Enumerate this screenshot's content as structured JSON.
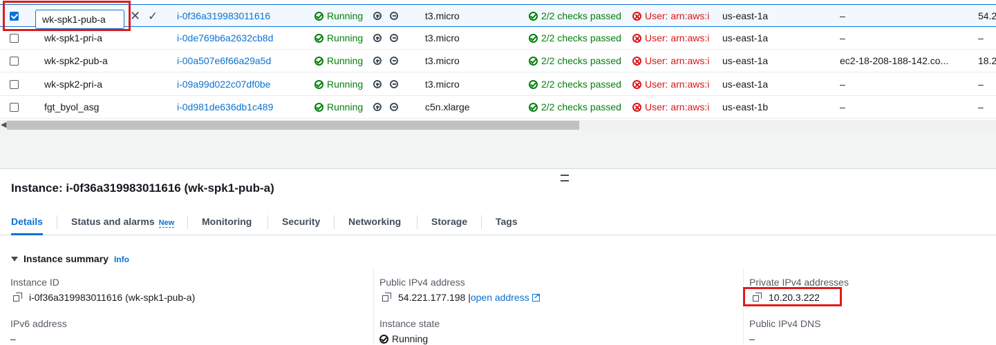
{
  "rows": [
    {
      "name": "wk-spk1-pub-a",
      "id": "i-0f36a319983011616",
      "state": "Running",
      "type": "t3.micro",
      "checks": "2/2 checks passed",
      "alarm": "User: arn:aws:i",
      "az": "us-east-1a",
      "dns": "–",
      "ip": "54.2",
      "selected": true,
      "editing": true
    },
    {
      "name": "wk-spk1-pri-a",
      "id": "i-0de769b6a2632cb8d",
      "state": "Running",
      "type": "t3.micro",
      "checks": "2/2 checks passed",
      "alarm": "User: arn:aws:i",
      "az": "us-east-1a",
      "dns": "–",
      "ip": "–"
    },
    {
      "name": "wk-spk2-pub-a",
      "id": "i-00a507e6f66a29a5d",
      "state": "Running",
      "type": "t3.micro",
      "checks": "2/2 checks passed",
      "alarm": "User: arn:aws:i",
      "az": "us-east-1a",
      "dns": "ec2-18-208-188-142.co...",
      "ip": "18.2"
    },
    {
      "name": "wk-spk2-pri-a",
      "id": "i-09a99d022c07df0be",
      "state": "Running",
      "type": "t3.micro",
      "checks": "2/2 checks passed",
      "alarm": "User: arn:aws:i",
      "az": "us-east-1a",
      "dns": "–",
      "ip": "–"
    },
    {
      "name": "fgt_byol_asg",
      "id": "i-0d981de636db1c489",
      "state": "Running",
      "type": "c5n.xlarge",
      "checks": "2/2 checks passed",
      "alarm": "User: arn:aws:i",
      "az": "us-east-1b",
      "dns": "–",
      "ip": "–"
    }
  ],
  "edit": {
    "value": "wk-spk1-pub-a",
    "cancel_icon": "close-icon",
    "confirm_icon": "check-icon"
  },
  "details": {
    "title": "Instance: i-0f36a319983011616 (wk-spk1-pub-a)",
    "tabs": [
      {
        "label": "Details",
        "active": true
      },
      {
        "label": "Status and alarms",
        "badge": "New"
      },
      {
        "label": "Monitoring"
      },
      {
        "label": "Security"
      },
      {
        "label": "Networking"
      },
      {
        "label": "Storage"
      },
      {
        "label": "Tags"
      }
    ],
    "section_title": "Instance summary",
    "info_label": "Info",
    "fields": {
      "instance_id_label": "Instance ID",
      "instance_id_value": "i-0f36a319983011616 (wk-spk1-pub-a)",
      "public_ipv4_label": "Public IPv4 address",
      "public_ipv4_value": "54.221.177.198",
      "public_ipv4_sep": "|",
      "open_address": "open address",
      "private_ipv4_label": "Private IPv4 addresses",
      "private_ipv4_value": "10.20.3.222",
      "ipv6_label": "IPv6 address",
      "ipv6_value": "–",
      "instance_state_label": "Instance state",
      "instance_state_value": "Running",
      "public_dns_label": "Public IPv4 DNS",
      "public_dns_value": "–"
    }
  },
  "colors": {
    "accent": "#0972d3",
    "success": "#037f0c",
    "error": "#d91515",
    "highlight": "#e11a1a"
  }
}
